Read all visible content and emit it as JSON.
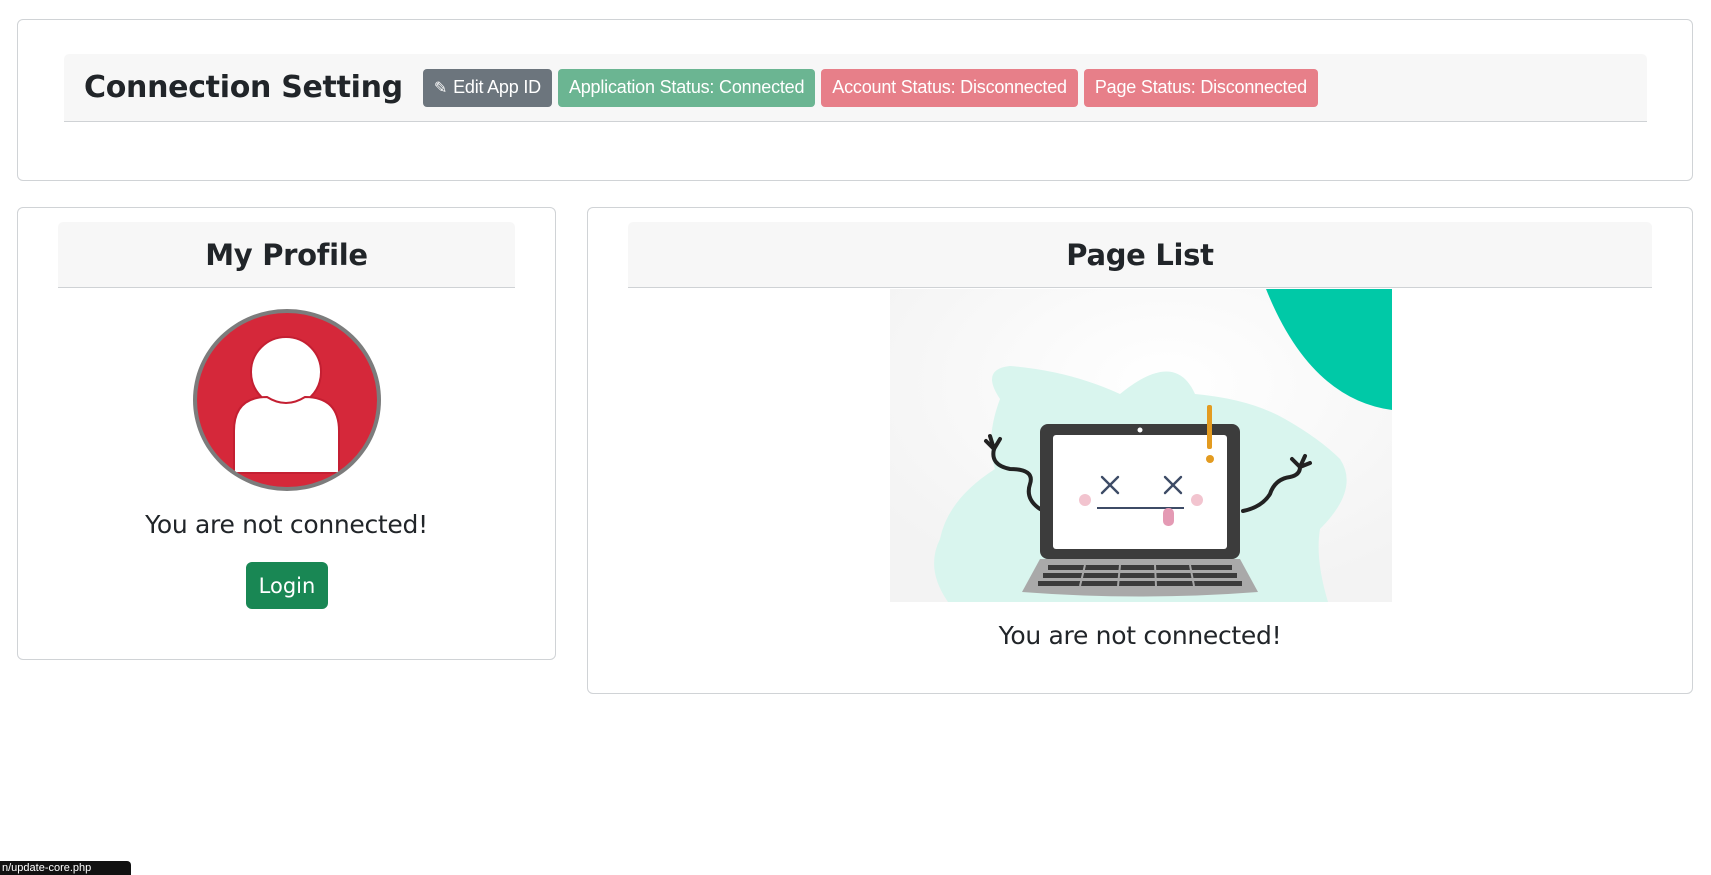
{
  "connection": {
    "title": "Connection Setting",
    "edit_button_icon": "pencil-icon",
    "edit_button_label": "Edit App ID",
    "badges": {
      "application": "Application Status: Connected",
      "account": "Account Status: Disconnected",
      "page": "Page Status: Disconnected"
    }
  },
  "profile": {
    "title": "My Profile",
    "avatar_icon": "user-icon",
    "status": "You are not connected!",
    "login_label": "Login"
  },
  "pages": {
    "title": "Page List",
    "illustration": "broken-laptop-illustration",
    "status": "You are not connected!"
  },
  "status_bar": {
    "url": "n/update-core.php"
  },
  "colors": {
    "connected": "#6bb592",
    "disconnected": "#e77f89",
    "secondary": "#6c757d",
    "login": "#198754",
    "avatar": "#d5283a",
    "accent_teal": "#00c9a7"
  }
}
